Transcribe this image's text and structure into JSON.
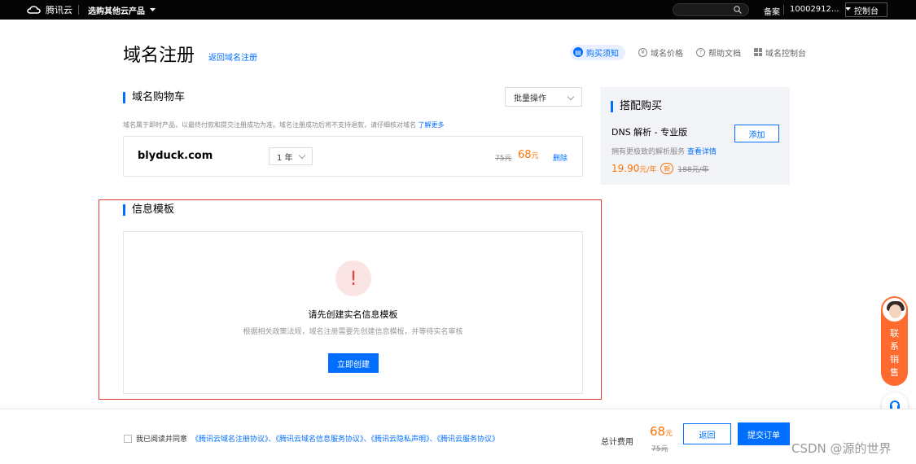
{
  "topbar": {
    "logo_text": "腾讯云",
    "products_label": "选购其他云产品",
    "beian": "备案",
    "account": "10002912...",
    "console": "控制台"
  },
  "header": {
    "title": "域名注册",
    "back_link": "返回域名注册",
    "nav": {
      "purchase_notice": "购买须知",
      "price": "域名价格",
      "help": "帮助文档",
      "console": "域名控制台"
    }
  },
  "cart": {
    "title": "域名购物车",
    "batch_label": "批量操作",
    "note": "域名属于即时产品，以最终付款和提交注册成功为准。域名注册成功后将不支持退款，请仔细核对域名",
    "note_link": "了解更多",
    "items": [
      {
        "domain": "blyduck.com",
        "period": "1 年",
        "original_price": "75元",
        "price": "68",
        "price_unit": "元",
        "delete_label": "删除"
      }
    ]
  },
  "bundle": {
    "title": "搭配购买",
    "product": "DNS 解析 - 专业版",
    "add_label": "添加",
    "desc": "拥有更极致的解析服务",
    "desc_link": "查看详情",
    "price": "19.90",
    "price_unit": "元/年",
    "new_badge": "新",
    "original_price": "188元/年"
  },
  "template": {
    "title": "信息模板",
    "warn_symbol": "!",
    "empty_title": "请先创建实名信息模板",
    "empty_desc": "根据相关政策法规，域名注册需要先创建信息模板，并等待实名审核",
    "create_label": "立即创建"
  },
  "float": {
    "sales_label": "联系销售"
  },
  "footer": {
    "agree_prefix": "我已阅读并同意",
    "agreements": "《腾讯云域名注册协议》、《腾讯云域名信息服务协议》、《腾讯云隐私声明》、《腾讯云服务协议》",
    "total_label": "总计费用",
    "total_price": "68",
    "total_unit": "元",
    "total_original": "75元",
    "return_label": "返回",
    "submit_label": "提交订单"
  },
  "watermark": "CSDN @源的世界",
  "colors": {
    "brand": "#006eff",
    "price": "#ff7200",
    "warn": "#e54545",
    "highlight_frame": "#e53935"
  }
}
